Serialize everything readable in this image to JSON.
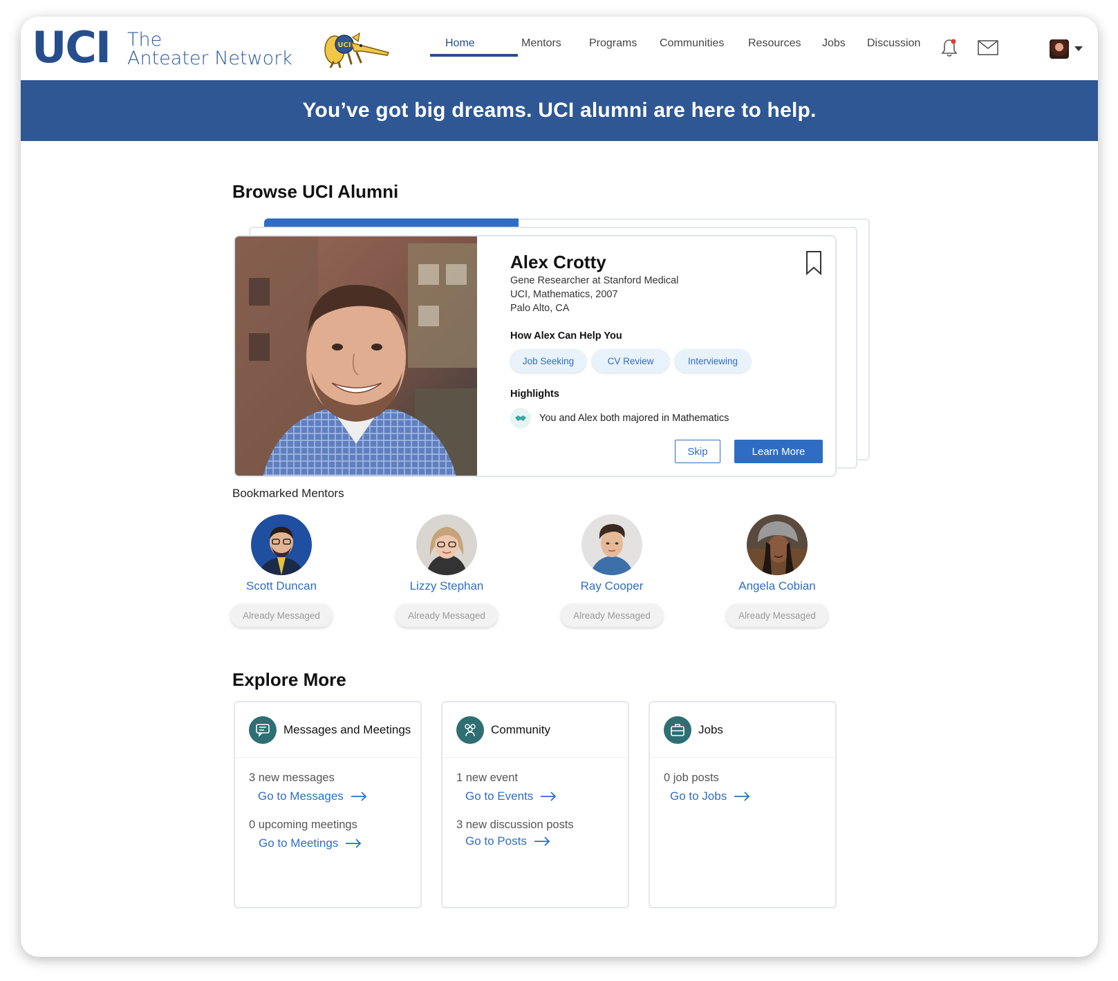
{
  "brand": {
    "logo_text": "UCI",
    "sub_line1": "The",
    "sub_line2": "Anteater Network",
    "mascot_badge": "UCI"
  },
  "nav": {
    "items": [
      {
        "label": "Home",
        "active": true
      },
      {
        "label": "Mentors"
      },
      {
        "label": "Programs"
      },
      {
        "label": "Communities"
      },
      {
        "label": "Resources"
      },
      {
        "label": "Jobs"
      },
      {
        "label": "Discussion"
      }
    ],
    "icons": [
      "bell-icon",
      "mail-icon",
      "avatar",
      "chevron-down-icon"
    ]
  },
  "banner": {
    "text": "You’ve got big dreams. UCI alumni are here to help."
  },
  "browse": {
    "title": "Browse UCI Alumni",
    "progress_fraction": 0.42,
    "mentor": {
      "name": "Alex Crotty",
      "role": "Gene Researcher at Stanford Medical",
      "education": "UCI, Mathematics, 2007",
      "location": "Palo Alto, CA",
      "help_title": "How Alex Can Help You",
      "help_tags": [
        "Job Seeking",
        "CV Review",
        "Interviewing"
      ],
      "highlights_title": "Highlights",
      "highlight": "You and Alex both majored in Mathematics",
      "skip_label": "Skip",
      "learn_label": "Learn More"
    }
  },
  "bookmarked": {
    "title": "Bookmarked Mentors",
    "mentors": [
      {
        "name": "Scott Duncan",
        "status": "Already Messaged"
      },
      {
        "name": "Lizzy Stephan",
        "status": "Already Messaged"
      },
      {
        "name": "Ray Cooper",
        "status": "Already Messaged"
      },
      {
        "name": "Angela Cobian",
        "status": "Already Messaged"
      }
    ]
  },
  "explore": {
    "title": "Explore More",
    "cards": [
      {
        "title": "Messages and Meetings",
        "icon": "chat-icon",
        "lines": [
          {
            "text": "3 new messages",
            "link": "Go to Messages"
          },
          {
            "text": "0 upcoming meetings",
            "link": "Go to Meetings"
          }
        ]
      },
      {
        "title": "Community",
        "icon": "people-icon",
        "lines": [
          {
            "text": "1 new event",
            "link": "Go to Events"
          },
          {
            "text": "3 new discussion posts",
            "link": "Go to Posts"
          }
        ]
      },
      {
        "title": "Jobs",
        "icon": "briefcase-icon",
        "lines": [
          {
            "text": "0 job posts",
            "link": "Go to Jobs"
          }
        ]
      }
    ]
  },
  "colors": {
    "brand_blue": "#274e8c",
    "banner_blue": "#2f5793",
    "accent_blue": "#2f6dc4",
    "teal": "#2d6f72"
  }
}
